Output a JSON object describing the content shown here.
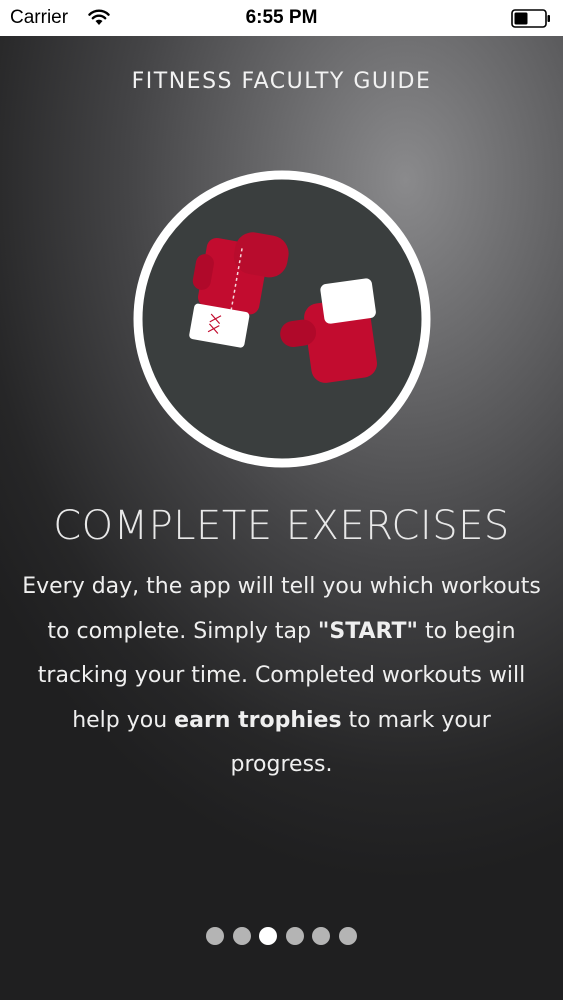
{
  "status_bar": {
    "carrier": "Carrier",
    "time": "6:55 PM",
    "wifi_icon": "wifi-icon",
    "battery_icon": "battery-icon"
  },
  "app_title": "FITNESS FACULTY GUIDE",
  "illustration": {
    "icon": "boxing-gloves-icon",
    "circle_color": "#3a3e3e",
    "ring_color": "#ffffff",
    "glove_color": "#c20c2f"
  },
  "section": {
    "heading": "COMPLETE EXERCISES",
    "body_1": "Every day, the app will tell you which workouts to complete. Simply tap ",
    "body_bold_1": "\"START\"",
    "body_2": " to begin tracking your time. Completed workouts will help you ",
    "body_bold_2": "earn trophies",
    "body_3": " to mark your progress."
  },
  "pager": {
    "total_pages": 6,
    "current_page": 3
  }
}
